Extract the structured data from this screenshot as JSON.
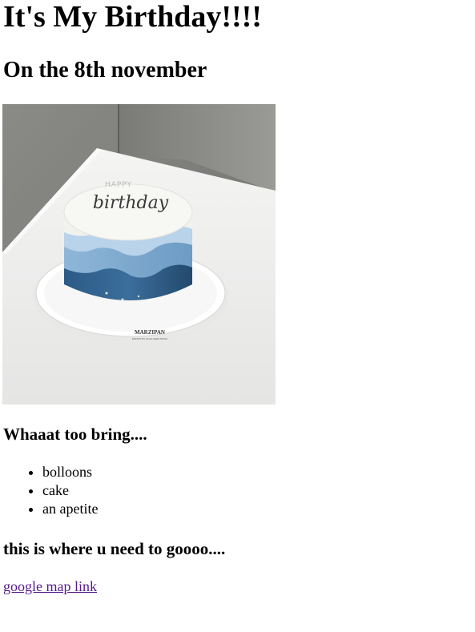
{
  "page": {
    "heading": "It's My Birthday!!!!",
    "subheading": "On the 8th november",
    "photo": {
      "alt": "",
      "cake_top_line": "HAPPY",
      "cake_script": "birthday",
      "board_brand": "MARZIPAN",
      "board_tagline": "PASTRY BY OLGA SHEVTSOVA"
    },
    "bring_heading": "Whaaat too bring....",
    "bring_items": [
      "bolloons",
      "cake",
      "an apetite"
    ],
    "location_heading": "this is where u need to goooo....",
    "map_link_text": "google map link"
  },
  "colors": {
    "link": "#551a8b",
    "text": "#000000",
    "background": "#ffffff"
  }
}
